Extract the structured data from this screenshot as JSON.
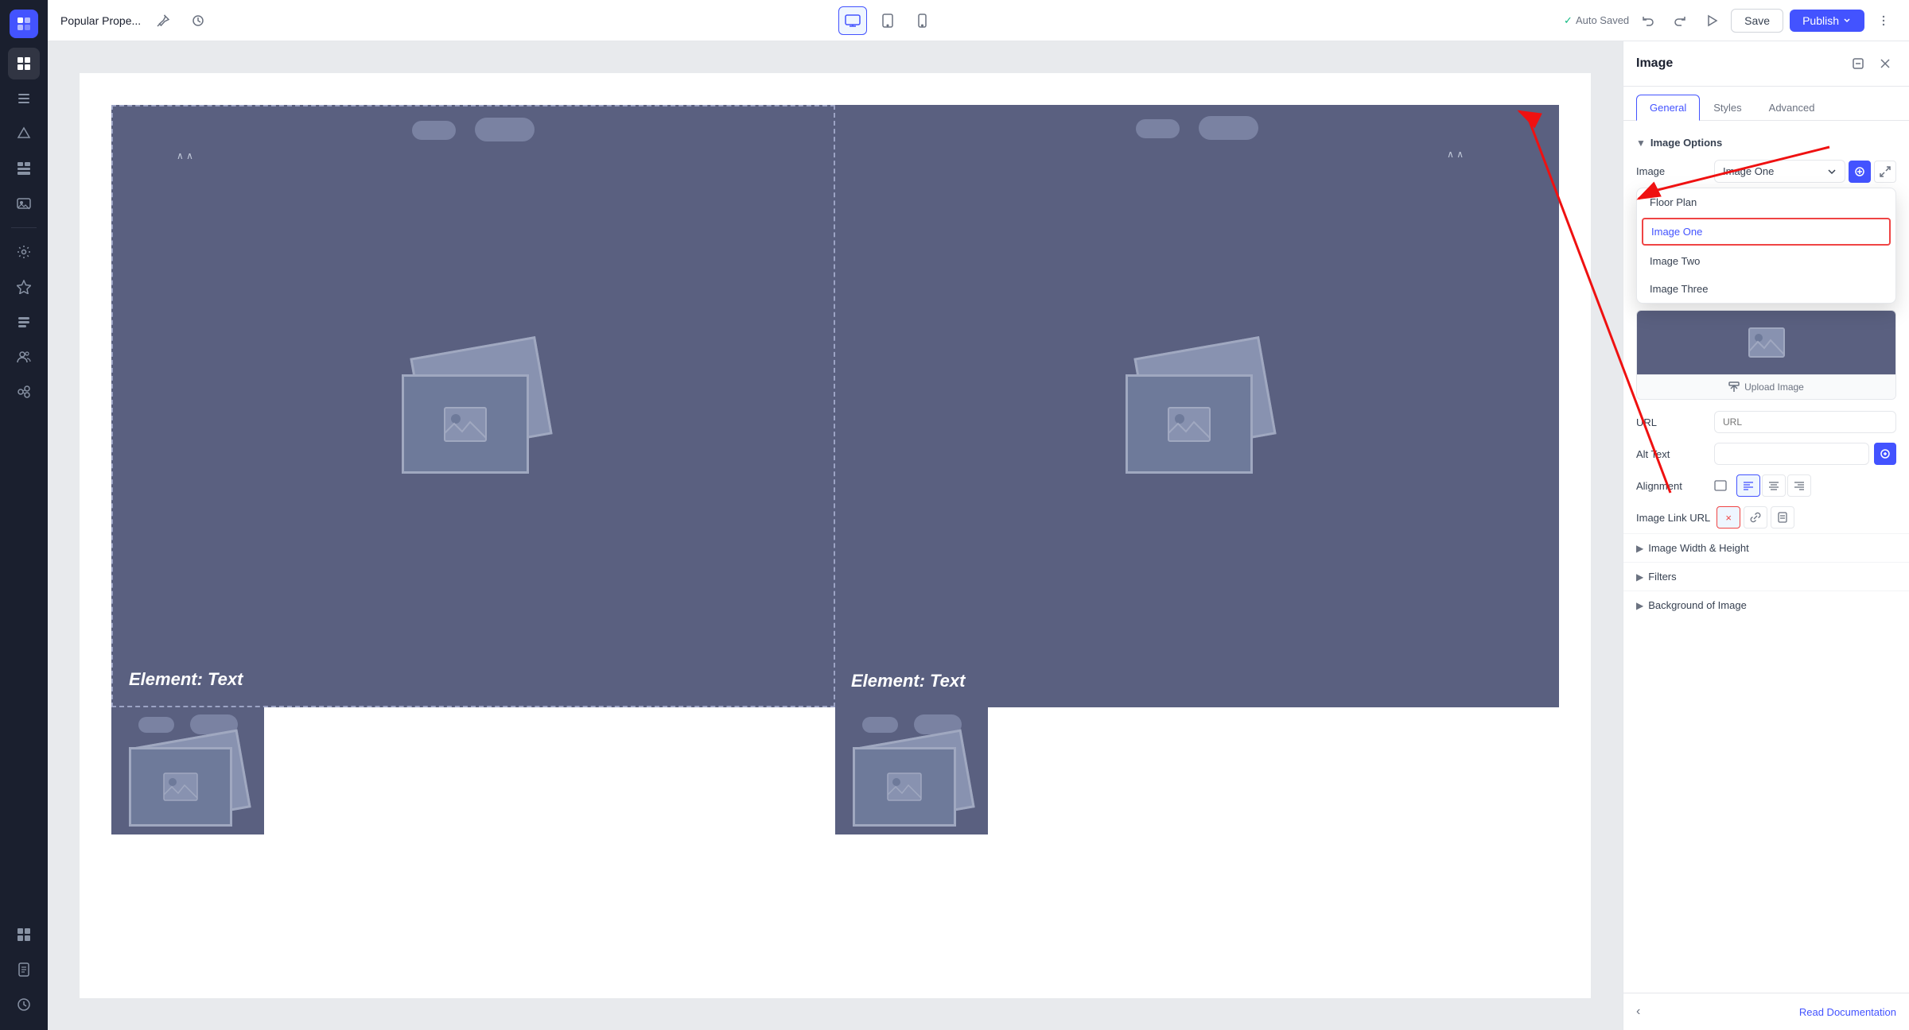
{
  "app": {
    "title": "Popular Prope...",
    "auto_saved": "Auto Saved"
  },
  "topbar": {
    "title": "Popular Prope...",
    "save_label": "Save",
    "publish_label": "Publish",
    "devices": [
      {
        "id": "desktop",
        "icon": "🖥",
        "active": true
      },
      {
        "id": "tablet",
        "icon": "⬜"
      },
      {
        "id": "mobile",
        "icon": "📱"
      }
    ]
  },
  "sidebar": {
    "items": [
      {
        "id": "grid",
        "icon": "⊞"
      },
      {
        "id": "layers",
        "icon": "▤"
      },
      {
        "id": "shapes",
        "icon": "✦"
      },
      {
        "id": "widgets",
        "icon": "⊟"
      },
      {
        "id": "media",
        "icon": "⊞"
      },
      {
        "id": "settings",
        "icon": "⚙"
      },
      {
        "id": "plugins",
        "icon": "⬡"
      },
      {
        "id": "list",
        "icon": "≡"
      },
      {
        "id": "users",
        "icon": "👥"
      },
      {
        "id": "integrations",
        "icon": "✱"
      }
    ],
    "bottom_items": [
      {
        "id": "components",
        "icon": "⊞"
      },
      {
        "id": "pages",
        "icon": "▤"
      },
      {
        "id": "history",
        "icon": "↺"
      }
    ]
  },
  "canvas": {
    "cards": [
      {
        "id": "card1",
        "text": "Element: Text",
        "selected": true
      },
      {
        "id": "card2",
        "text": "Element: Text"
      },
      {
        "id": "card3",
        "text": ""
      },
      {
        "id": "card4",
        "text": ""
      }
    ]
  },
  "right_panel": {
    "title": "Image",
    "tabs": [
      {
        "id": "general",
        "label": "General",
        "active": true
      },
      {
        "id": "styles",
        "label": "Styles"
      },
      {
        "id": "advanced",
        "label": "Advanced"
      }
    ],
    "sections": {
      "image_options": {
        "label": "Image Options",
        "expanded": true
      }
    },
    "fields": {
      "image": {
        "label": "Image",
        "upload_label": "Upload Image",
        "dropdown": {
          "options": [
            "Floor Plan",
            "Image One",
            "Image Two",
            "Image Three"
          ],
          "selected": "Image One",
          "selected_index": 1
        }
      },
      "url": {
        "label": "URL",
        "placeholder": "URL",
        "value": ""
      },
      "alt_text": {
        "label": "Alt Text",
        "placeholder": "",
        "value": ""
      },
      "alignment": {
        "label": "Alignment",
        "options": [
          "left",
          "center",
          "right"
        ],
        "active": "left"
      },
      "image_link_url": {
        "label": "Image Link URL",
        "clear_btn": "×",
        "link_btn": "🔗",
        "page_btn": "⬜"
      }
    },
    "collapsibles": [
      {
        "id": "image-width-height",
        "label": "Image Width & Height"
      },
      {
        "id": "filters",
        "label": "Filters"
      },
      {
        "id": "background-of-image",
        "label": "Background of Image"
      }
    ],
    "footer": {
      "nav_icon": "‹",
      "link": "Read Documentation"
    }
  }
}
